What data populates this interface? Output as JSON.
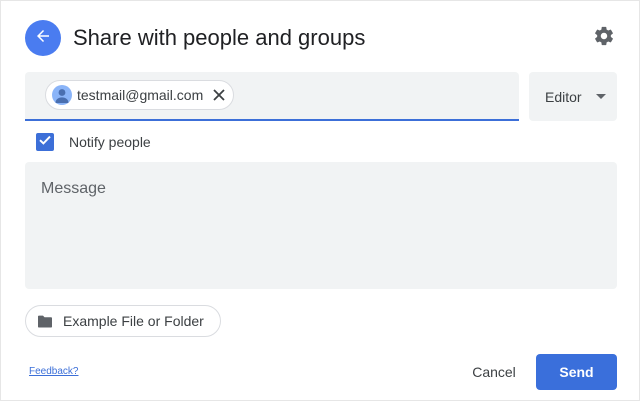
{
  "dialog": {
    "title": "Share with people and groups",
    "icons": {
      "back": "arrow-left-icon",
      "settings": "gear-icon"
    }
  },
  "recipients": {
    "chips": [
      {
        "email": "testmail@gmail.com",
        "avatar_icon": "person-icon",
        "remove_icon": "close-icon"
      }
    ]
  },
  "role": {
    "selected": "Editor",
    "caret_icon": "caret-down-icon"
  },
  "notify": {
    "label": "Notify people",
    "checked": true
  },
  "message": {
    "placeholder": "Message"
  },
  "attachment": {
    "label": "Example File or Folder",
    "icon": "folder-icon"
  },
  "footer": {
    "feedback_label": "Feedback?",
    "cancel_label": "Cancel",
    "send_label": "Send"
  },
  "colors": {
    "accent": "#3a6fdb",
    "back_button": "#4a7cf0",
    "field_background": "#f1f3f4"
  }
}
